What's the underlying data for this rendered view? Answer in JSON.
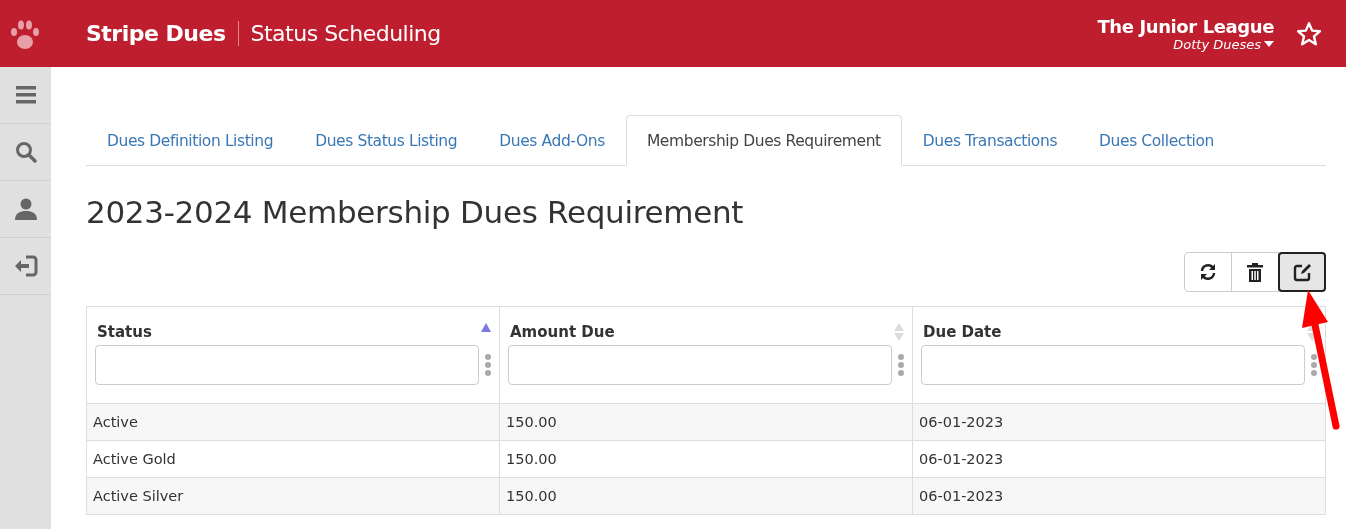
{
  "header": {
    "app_name": "Stripe Dues",
    "page_title": "Status Scheduling",
    "org": "The Junior League",
    "user": "Dotty Dueses"
  },
  "sidebar": {
    "items": [
      {
        "kind": "menu"
      },
      {
        "kind": "search"
      },
      {
        "kind": "user"
      },
      {
        "kind": "logout"
      }
    ]
  },
  "tabs": [
    {
      "label": "Dues Definition Listing",
      "selected": false
    },
    {
      "label": "Dues Status Listing",
      "selected": false
    },
    {
      "label": "Dues Add-Ons",
      "selected": false
    },
    {
      "label": "Membership Dues Requirement",
      "selected": true
    },
    {
      "label": "Dues Transactions",
      "selected": false
    },
    {
      "label": "Dues Collection",
      "selected": false
    }
  ],
  "heading": "2023-2024 Membership Dues Requirement",
  "toolbar": [
    {
      "kind": "refresh",
      "selected": false
    },
    {
      "kind": "delete",
      "selected": false
    },
    {
      "kind": "edit",
      "selected": true
    }
  ],
  "table": {
    "columns": [
      {
        "label": "Status",
        "sorted": true
      },
      {
        "label": "Amount Due",
        "sorted": false
      },
      {
        "label": "Due Date",
        "sorted": false
      }
    ],
    "rows": [
      [
        "Active",
        "150.00",
        "06-01-2023"
      ],
      [
        "Active Gold",
        "150.00",
        "06-01-2023"
      ],
      [
        "Active Silver",
        "150.00",
        "06-01-2023"
      ]
    ]
  }
}
